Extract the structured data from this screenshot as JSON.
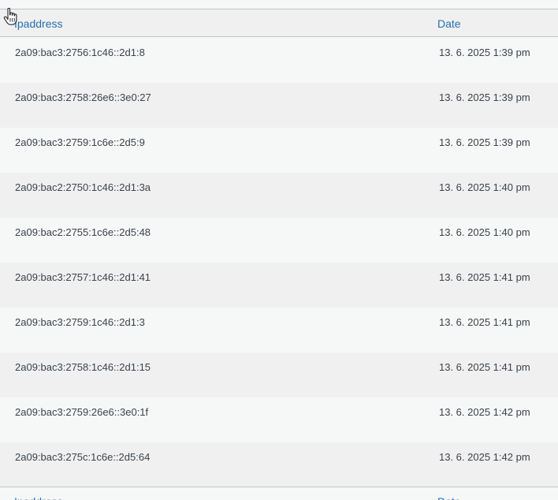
{
  "table": {
    "columns": {
      "ip": "Ipaddress",
      "date": "Date"
    },
    "rows": [
      {
        "ip": "2a09:bac3:2756:1c46::2d1:8",
        "date": "13. 6. 2025 1:39 pm"
      },
      {
        "ip": "2a09:bac3:2758:26e6::3e0:27",
        "date": "13. 6. 2025 1:39 pm"
      },
      {
        "ip": "2a09:bac3:2759:1c6e::2d5:9",
        "date": "13. 6. 2025 1:39 pm"
      },
      {
        "ip": "2a09:bac2:2750:1c46::2d1:3a",
        "date": "13. 6. 2025 1:40 pm"
      },
      {
        "ip": "2a09:bac2:2755:1c6e::2d5:48",
        "date": "13. 6. 2025 1:40 pm"
      },
      {
        "ip": "2a09:bac3:2757:1c46::2d1:41",
        "date": "13. 6. 2025 1:41 pm"
      },
      {
        "ip": "2a09:bac3:2759:1c46::2d1:3",
        "date": "13. 6. 2025 1:41 pm"
      },
      {
        "ip": "2a09:bac3:2758:1c46::2d1:15",
        "date": "13. 6. 2025 1:41 pm"
      },
      {
        "ip": "2a09:bac3:2759:26e6::3e0:1f",
        "date": "13. 6. 2025 1:42 pm"
      },
      {
        "ip": "2a09:bac3:275c:1c6e::2d5:64",
        "date": "13. 6. 2025 1:42 pm"
      }
    ]
  },
  "cursor": {
    "icon": "hand-pointer-icon"
  }
}
